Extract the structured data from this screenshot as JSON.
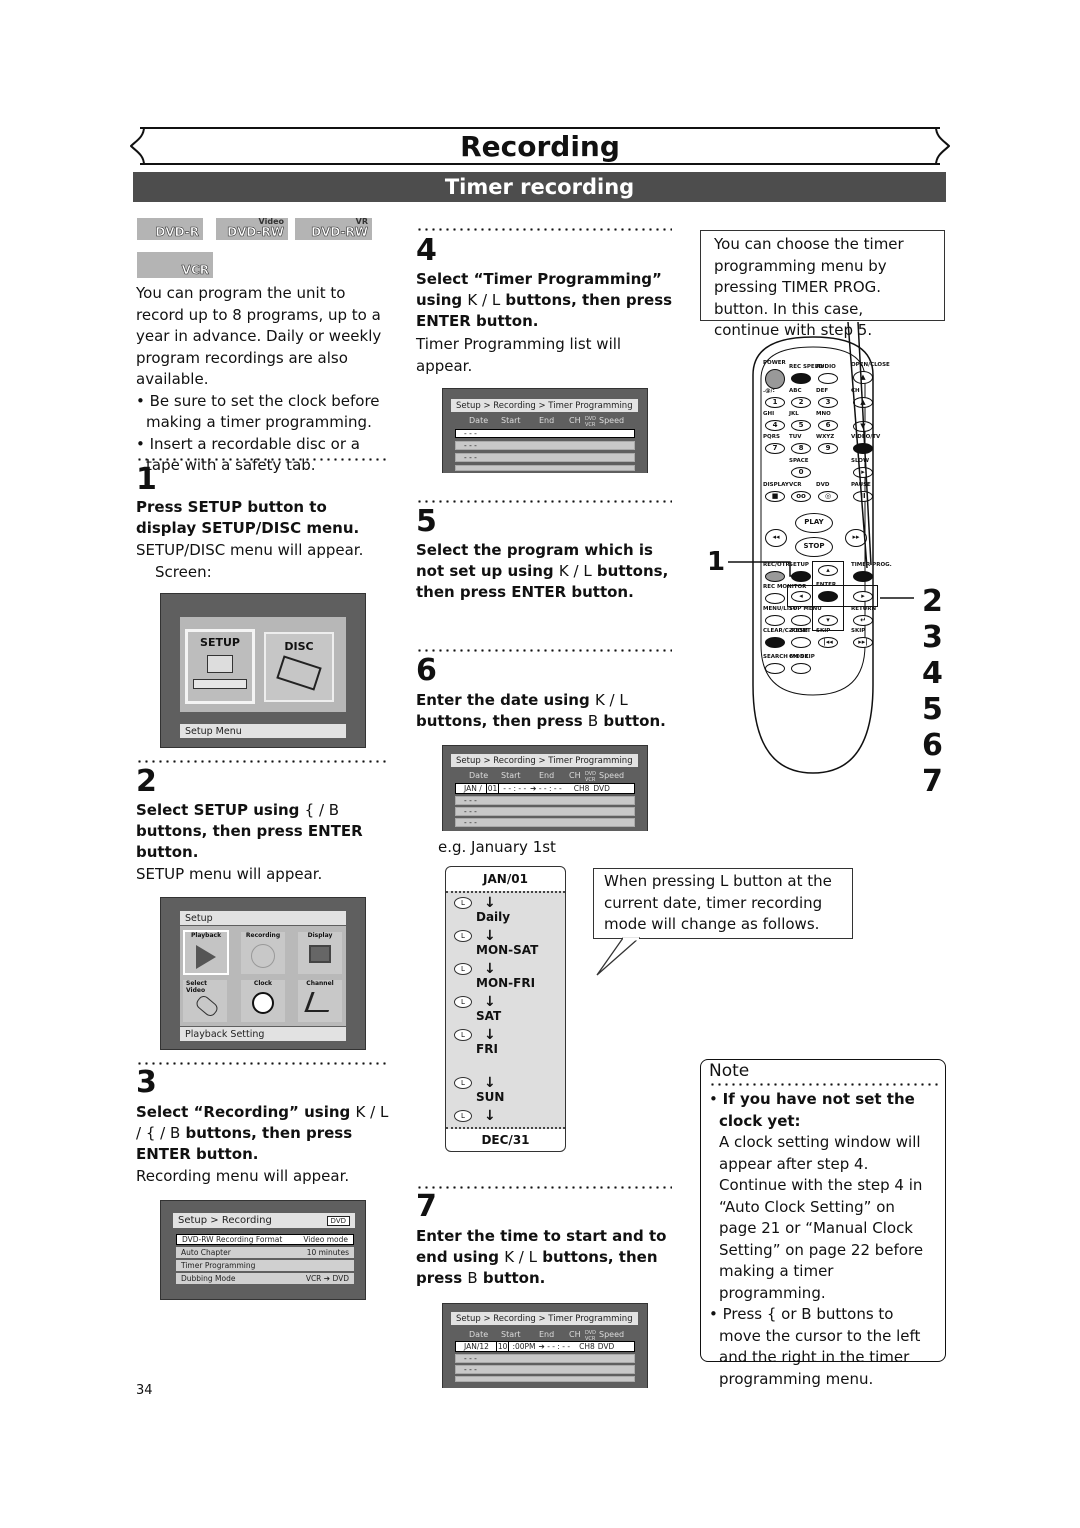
{
  "header": {
    "section_title": "Recording",
    "subsection_title": "Timer recording"
  },
  "media_logos": [
    {
      "label": "DVD-R",
      "sup": ""
    },
    {
      "label": "DVD-RW",
      "sup": "Video"
    },
    {
      "label": "DVD-RW",
      "sup": "VR"
    },
    {
      "label": "VCR",
      "sup": ""
    }
  ],
  "intro": {
    "text": "You can program the unit to record up to 8 programs, up to a year in advance. Daily or weekly program recordings are also available.",
    "bullets": [
      "Be sure to set the clock before making a timer programming.",
      "Insert a recordable disc or a tape with a safety tab."
    ]
  },
  "steps": [
    {
      "num": "1",
      "heading": "Press SETUP button to display SETUP/DISC menu.",
      "desc": "SETUP/DISC menu will appear.",
      "extra": "Screen:"
    },
    {
      "num": "2",
      "heading_parts": [
        "Select SETUP using ",
        "{ / B",
        " buttons, then press ENTER button."
      ],
      "desc": "SETUP menu will appear."
    },
    {
      "num": "3",
      "heading_parts": [
        "Select “Recording” using ",
        "K / L / { / B",
        " buttons, then press ENTER button."
      ],
      "desc": "Recording menu will appear."
    },
    {
      "num": "4",
      "heading_parts": [
        "Select “Timer Programming” using ",
        "K / L",
        " buttons, then press ENTER button."
      ],
      "desc": "Timer Programming list will appear."
    },
    {
      "num": "5",
      "heading_parts": [
        "Select the program which is not set up using ",
        "K / L",
        " buttons, then press ENTER button."
      ]
    },
    {
      "num": "6",
      "heading_parts": [
        "Enter the date using ",
        "K / L",
        " buttons, then press ",
        "B",
        " button."
      ],
      "caption": "e.g. January 1st"
    },
    {
      "num": "7",
      "heading_parts": [
        "Enter the time to start and to end using ",
        "K / L",
        " buttons, then press ",
        "B",
        " button."
      ]
    }
  ],
  "screen_setup_disc": {
    "tiles": [
      "SETUP",
      "DISC"
    ],
    "status": "Setup Menu"
  },
  "screen_setup": {
    "title": "Setup",
    "tiles": [
      "Playback",
      "Recording",
      "Display",
      "Select Video",
      "Clock",
      "Channel"
    ],
    "status": "Playback Setting"
  },
  "screen_recording": {
    "breadcrumb": "Setup > Recording",
    "badge": "DVD",
    "rows": [
      {
        "label": "DVD-RW Recording Format",
        "value": "Video mode"
      },
      {
        "label": "Auto Chapter",
        "value": "10 minutes"
      },
      {
        "label": "Timer Programming",
        "value": ""
      },
      {
        "label": "Dubbing Mode",
        "value": "VCR ➔ DVD"
      }
    ]
  },
  "timer_screen": {
    "breadcrumb": "Setup > Recording > Timer Programming",
    "columns": [
      "Date",
      "Start",
      "End",
      "CH",
      "DVD VCR",
      "Speed"
    ],
    "empty_row": "- - -",
    "step4_rows": [
      "- - -",
      "- - -",
      "- - -"
    ],
    "step6_row": {
      "date": "JAN /",
      "date_cursor": "01",
      "start": "- - : - -",
      "end": "➔ - - : - -",
      "ch": "CH8",
      "media": "DVD"
    },
    "step7_row": {
      "date": "JAN/12",
      "start_cursor": "10",
      "start": ":00PM",
      "end": "➔ - - : - -",
      "ch": "CH8",
      "media": "DVD"
    }
  },
  "date_flow": {
    "top": "JAN/01",
    "items": [
      "Daily",
      "MON-SAT",
      "MON-FRI",
      "SAT",
      "FRI",
      "SUN"
    ],
    "bottom": "DEC/31",
    "button_symbol": "L"
  },
  "callout_timer_prog": "You can choose the timer programming menu by pressing TIMER PROG. button. In this case, continue with step 5.",
  "callout_date": "When pressing L button at the current date, timer recording mode will change as follows.",
  "remote": {
    "labels": [
      "POWER",
      "REC SPEED",
      "AUDIO",
      "OPEN/CLOSE",
      ".@/:",
      "ABC",
      "DEF",
      "CH",
      "GHI",
      "JKL",
      "MNO",
      "PQRS",
      "TUV",
      "WXYZ",
      "VIDEO/TV",
      "SPACE",
      "SLOW",
      "DISPLAY",
      "VCR",
      "DVD",
      "PAUSE",
      "PLAY",
      "STOP",
      "REC/OTR",
      "SETUP",
      "TIMER PROG.",
      "REC MONITOR",
      "ENTER",
      "MENU/LIST",
      "TOP MENU",
      "RETURN",
      "CLEAR/C-RESET",
      "ZOOM",
      "SKIP",
      "SKIP",
      "SEARCH MODE",
      "CM SKIP"
    ],
    "digits": [
      "1",
      "2",
      "3",
      "4",
      "5",
      "6",
      "7",
      "8",
      "9",
      "0"
    ],
    "step_markers": [
      "1",
      "2",
      "3",
      "4",
      "5",
      "6",
      "7"
    ]
  },
  "note": {
    "title": "Note",
    "items": [
      {
        "bold": "If you have not set the clock yet:",
        "text": "A clock setting window will appear after step 4. Continue with the step 4 in “Auto Clock Setting” on page 21 or “Manual Clock Setting” on page 22 before making a timer programming."
      },
      {
        "bold": "",
        "text": "Press { or B buttons to move the cursor to the left and the right in the timer programming menu."
      }
    ]
  },
  "page_number": "34"
}
